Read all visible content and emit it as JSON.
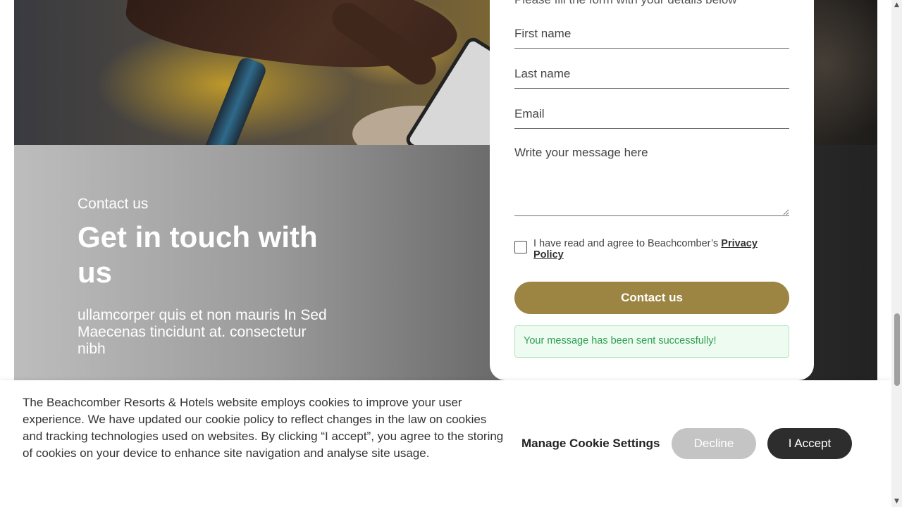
{
  "contact": {
    "eyebrow": "Contact us",
    "heading": "Get in touch with us",
    "lede": "ullamcorper quis et non mauris In Sed Maecenas tincidunt at. consectetur nibh"
  },
  "form": {
    "intro": "Please fill the form with your details below",
    "first_name_placeholder": "First name",
    "last_name_placeholder": "Last name",
    "email_placeholder": "Email",
    "message_placeholder": "Write your message here",
    "consent_text": "I have read and agree to Beachcomber’s ",
    "consent_link": "Privacy Policy",
    "submit_label": "Contact us",
    "success_message": "Your message has been sent successfully!"
  },
  "cookie": {
    "text": "The Beachcomber Resorts & Hotels website employs cookies to improve your user experience. We have updated our cookie policy to reflect changes in the law on cookies and tracking technologies used on websites. By clicking “I accept”, you agree to the storing of cookies on your device to enhance site navigation and analyse site usage.",
    "manage_label": "Manage Cookie Settings",
    "decline_label": "Decline",
    "accept_label": "I Accept"
  },
  "colors": {
    "accent": "#9c8542",
    "success": "#2e9e52",
    "accept_bg": "#2d2d2d",
    "decline_bg": "#c4c4c4"
  }
}
